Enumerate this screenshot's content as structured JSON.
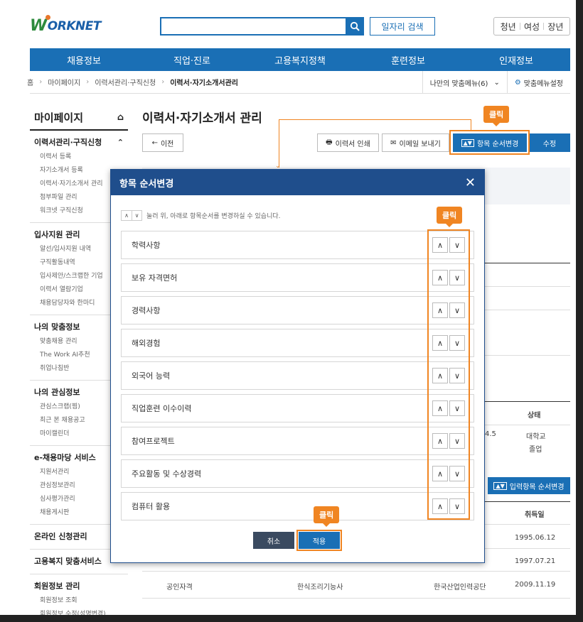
{
  "header": {
    "logo_text": "WORKNET",
    "search_placeholder": "",
    "job_search_label": "일자리 검색",
    "target_links": [
      "청년",
      "여성",
      "장년"
    ]
  },
  "gnb": [
    "채용정보",
    "직업·진로",
    "고용복지정책",
    "훈련정보",
    "인재정보"
  ],
  "breadcrumb": {
    "items": [
      "홈",
      "마이페이지",
      "이력서관리·구직신청"
    ],
    "current": "이력서·자기소개서관리",
    "my_menu": "나만의 맞춤메뉴(6)",
    "menu_settings": "맞춤메뉴설정"
  },
  "lnb": {
    "title": "마이페이지",
    "groups": [
      {
        "label": "이력서관리·구직신청",
        "items": [
          "이력서 등록",
          "자기소개서 등록",
          "이력서·자기소개서 관리",
          "첨부파일 관리",
          "워크넷 구직신청"
        ]
      },
      {
        "label": "입사지원 관리",
        "items": [
          "알선/입사지원 내역",
          "구직활동내역",
          "입사제안/스크랩한 기업",
          "이력서 열람기업",
          "채용담당자와 한마디"
        ]
      },
      {
        "label": "나의 맞춤정보",
        "items": [
          "맞춤채용 관리",
          "The Work AI추천",
          "취업나침반"
        ]
      },
      {
        "label": "나의 관심정보",
        "items": [
          "관심스크랩(찜)",
          "최근 본 채용공고",
          "마이캘린더"
        ]
      },
      {
        "label": "e-채용마당 서비스",
        "items": [
          "지원서관리",
          "관심정보관리",
          "심사평가관리",
          "채용게시판"
        ]
      },
      {
        "label": "온라인 신청관리",
        "items": []
      },
      {
        "label": "고용복지 맞춤서비스",
        "items": []
      },
      {
        "label": "회원정보 관리",
        "items": [
          "회원정보 조회",
          "회원정보 수정(성명변경)"
        ]
      }
    ]
  },
  "main": {
    "title": "이력서·자기소개서 관리",
    "prev_label": "이전",
    "print_label": "이력서 인쇄",
    "email_label": "이메일 보내기",
    "reorder_label": "항목 순서변경",
    "edit_label": "수정",
    "click_tag": "클릭"
  },
  "background": {
    "status_header": "상태",
    "status_value_1": "대학교",
    "status_value_2": "졸업",
    "partial_num": "4.5",
    "order_button": "입력항목 순서변경",
    "acquired_header": "취득일",
    "dates": [
      "1995.06.12",
      "1997.07.21"
    ],
    "last_row": {
      "type": "공인자격",
      "name": "한식조리기능사",
      "org": "한국산업인력공단",
      "date": "2009.11.19"
    }
  },
  "modal": {
    "title": "항목 순서변경",
    "hint": "눌러 위, 아래로 항목순서를 변경하실 수 있습니다.",
    "items": [
      "학력사항",
      "보유 자격면허",
      "경력사항",
      "해외경험",
      "외국어 능력",
      "직업훈련 이수이력",
      "참여프로젝트",
      "주요활동 및 수상경력",
      "컴퓨터 활용"
    ],
    "cancel_label": "취소",
    "apply_label": "적용",
    "click_tag": "클릭"
  },
  "colors": {
    "primary": "#1a6fb5",
    "modal_header": "#1f4e8c",
    "highlight": "#f08522"
  }
}
